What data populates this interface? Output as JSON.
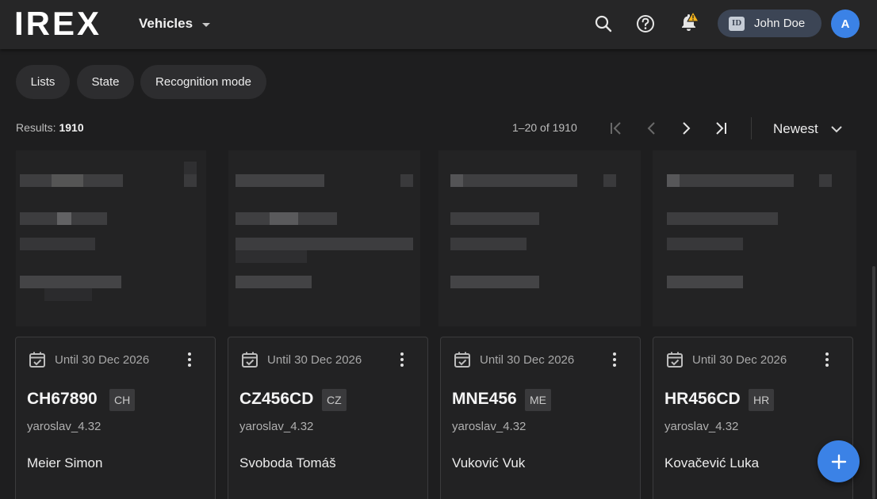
{
  "header": {
    "logo_text": "IREX",
    "section": "Vehicles",
    "user_name": "John Doe",
    "user_badge": "ID",
    "avatar_initial": "A",
    "icons": [
      "search-icon",
      "help-icon",
      "notifications-icon"
    ]
  },
  "filters": [
    "Lists",
    "State",
    "Recognition mode"
  ],
  "results": {
    "label": "Results:",
    "count": "1910"
  },
  "pagination": {
    "range_text": "1–20 of 1910"
  },
  "sort": {
    "value": "Newest"
  },
  "cards": [
    {
      "until": "Until 30 Dec 2026",
      "plate": "CH67890",
      "country": "CH",
      "owner": "yaroslav_4.32",
      "person": "Meier Simon"
    },
    {
      "until": "Until 30 Dec 2026",
      "plate": "CZ456CD",
      "country": "CZ",
      "owner": "yaroslav_4.32",
      "person": "Svoboda Tomáš"
    },
    {
      "until": "Until 30 Dec 2026",
      "plate": "MNE456",
      "country": "ME",
      "owner": "yaroslav_4.32",
      "person": "Vuković Vuk"
    },
    {
      "until": "Until 30 Dec 2026",
      "plate": "HR456CD",
      "country": "HR",
      "owner": "yaroslav_4.32",
      "person": "Kovačević Luka"
    }
  ],
  "colors": {
    "accent": "#3b82e6",
    "background": "#1e1e1f",
    "header": "#262627",
    "warning": "#f2b21c"
  }
}
